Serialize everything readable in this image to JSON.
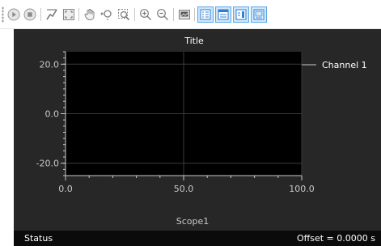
{
  "toolbar": {
    "buttons": [
      {
        "name": "run-icon",
        "active": false
      },
      {
        "name": "stop-icon",
        "active": false
      },
      {
        "name": "autoscale-icon",
        "active": false
      },
      {
        "name": "fit-view-icon",
        "active": false
      },
      {
        "name": "pan-hand-icon",
        "active": false
      },
      {
        "name": "zoom-xy-icon",
        "active": false
      },
      {
        "name": "zoom-box-icon",
        "active": false
      },
      {
        "name": "zoom-in-icon",
        "active": false
      },
      {
        "name": "zoom-out-icon",
        "active": false
      },
      {
        "name": "save-image-icon",
        "active": false
      },
      {
        "name": "legend-toggle-icon",
        "active": true
      },
      {
        "name": "properties-icon",
        "active": true
      },
      {
        "name": "cursor-measure-icon",
        "active": true
      },
      {
        "name": "data-table-icon",
        "active": true
      }
    ]
  },
  "chart_data": {
    "type": "line",
    "title": "Title",
    "xlabel": "",
    "ylabel": "",
    "footer": "Scope1",
    "xlim": [
      0,
      100
    ],
    "ylim": [
      -25,
      25
    ],
    "x_ticks": [
      "0.0",
      "50.0",
      "100.0"
    ],
    "y_ticks": [
      "20.0",
      "0.0",
      "-20.0"
    ],
    "series": [
      {
        "name": "Channel 1",
        "values": [],
        "color": "#c8c8c8"
      }
    ],
    "legend_position": "right",
    "grid": true,
    "plot_background": "#000000",
    "frame_background": "#272727"
  },
  "status": {
    "left": "Status",
    "right": "Offset = 0.0000 s"
  }
}
